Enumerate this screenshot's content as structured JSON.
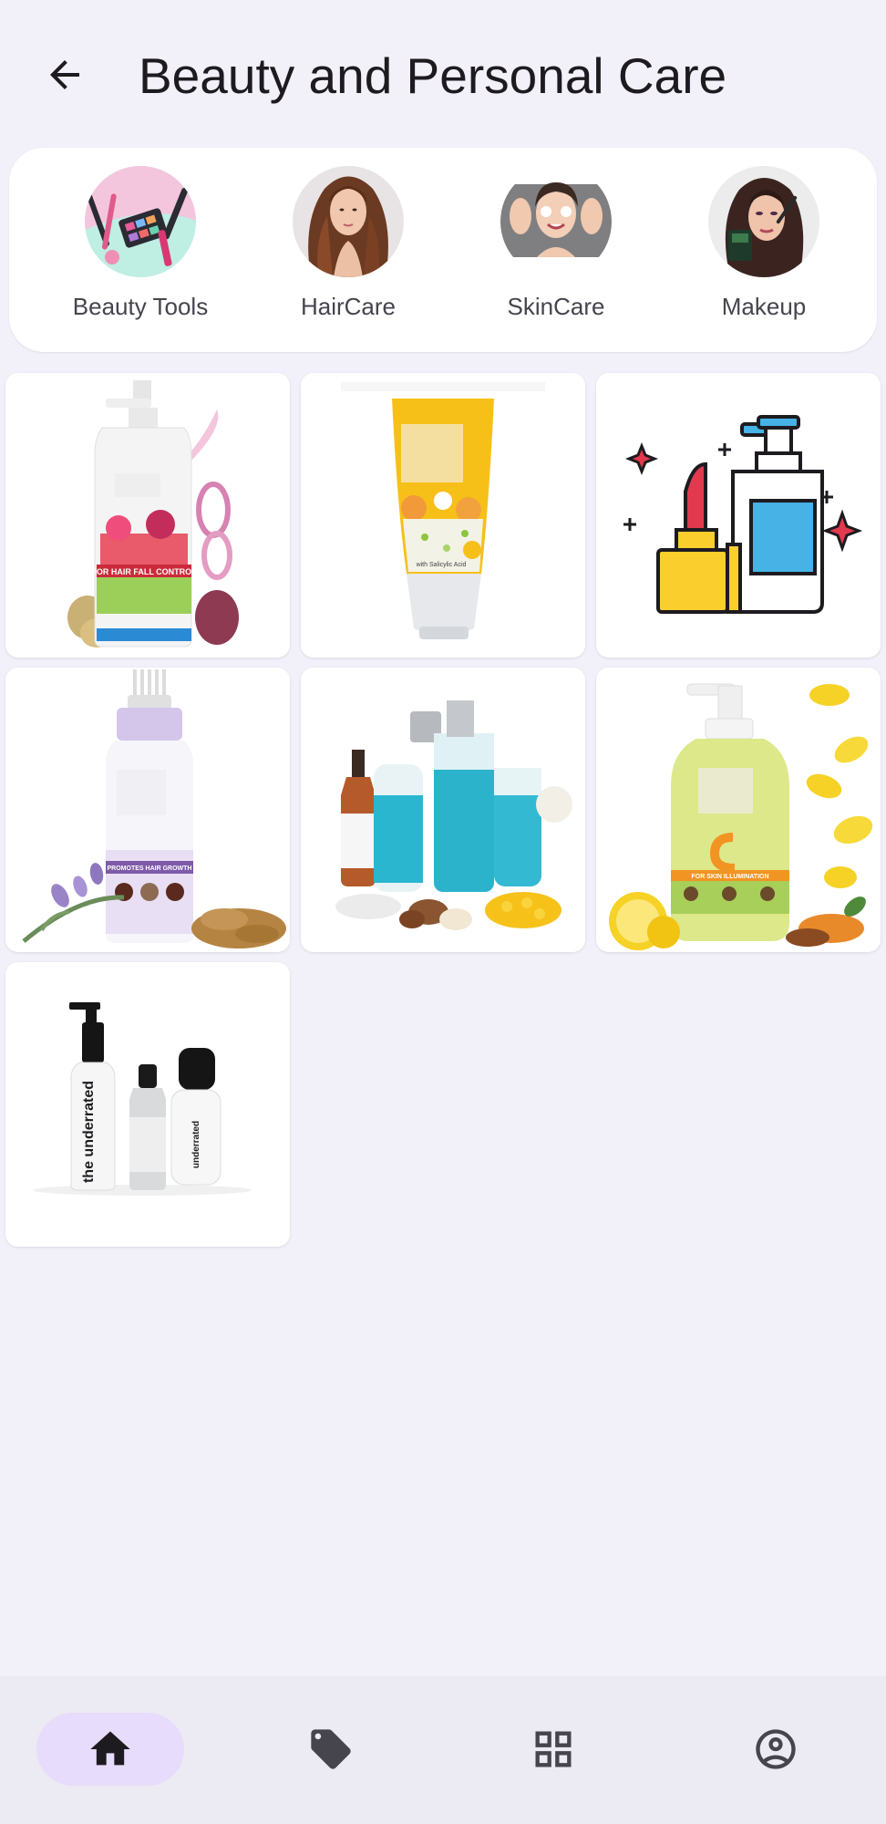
{
  "header": {
    "title": "Beauty and Personal Care",
    "back_icon": "arrow-back-icon"
  },
  "categories": [
    {
      "label": "Beauty Tools",
      "image": "makeup-brushes-photo"
    },
    {
      "label": "HairCare",
      "image": "woman-long-hair-photo"
    },
    {
      "label": "SkinCare",
      "image": "woman-applying-cream-photo"
    },
    {
      "label": "Makeup",
      "image": "woman-applying-eyeshadow-photo"
    }
  ],
  "products": [
    {
      "image": "hair-fall-control-shampoo-bottle",
      "text": "FOR HAIR FALL CONTROL"
    },
    {
      "image": "yellow-face-wash-tube",
      "text": "with Salicylic Acid"
    },
    {
      "image": "cosmetics-icon-lipstick-pump-bottle"
    },
    {
      "image": "hair-oil-applicator-bottle",
      "text": "PROMOTES HAIR GROWTH"
    },
    {
      "image": "blue-skincare-product-set"
    },
    {
      "image": "vitamin-c-face-wash-pump",
      "text": "FOR SKIN ILLUMINATION"
    },
    {
      "image": "underrated-skincare-set",
      "text": "the underrated"
    }
  ],
  "bottom_nav": [
    {
      "icon": "home-icon",
      "active": true
    },
    {
      "icon": "tag-icon",
      "active": false
    },
    {
      "icon": "grid-icon",
      "active": false
    },
    {
      "icon": "account-circle-icon",
      "active": false
    }
  ],
  "colors": {
    "background": "#f2f0f9",
    "card": "#ffffff",
    "nav_background": "#eceaf3",
    "nav_active_pill": "#e7dcfb",
    "icon_dark": "#1d1b20",
    "icon_muted": "#46444d"
  }
}
